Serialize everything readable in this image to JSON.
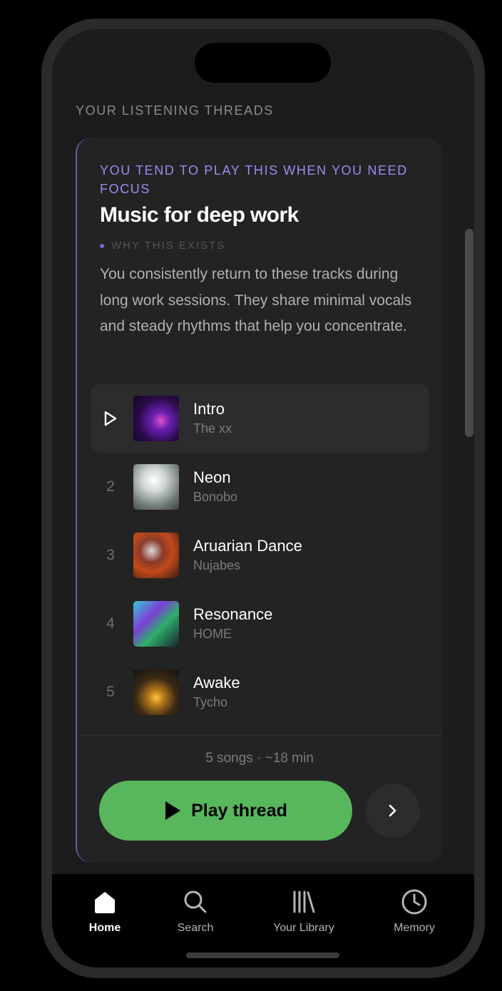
{
  "page": {
    "section_heading": "YOUR LISTENING THREADS"
  },
  "thread": {
    "context_label": "YOU TEND TO PLAY THIS WHEN YOU NEED FOCUS",
    "title": "Music for deep work",
    "why_label": "WHY THIS EXISTS",
    "description": "You consistently return to these tracks during long work sessions. They share minimal vocals and steady rhythms that help you concentrate.",
    "tracks": [
      {
        "number": "1",
        "title": "Intro",
        "artist": "The xx",
        "playing": true
      },
      {
        "number": "2",
        "title": "Neon",
        "artist": "Bonobo"
      },
      {
        "number": "3",
        "title": "Aruarian Dance",
        "artist": "Nujabes"
      },
      {
        "number": "4",
        "title": "Resonance",
        "artist": "HOME"
      },
      {
        "number": "5",
        "title": "Awake",
        "artist": "Tycho"
      }
    ],
    "summary": "5 songs · ~18 min",
    "play_label": "Play thread"
  },
  "tabbar": {
    "tabs": [
      {
        "label": "Home",
        "icon": "home-icon",
        "active": true
      },
      {
        "label": "Search",
        "icon": "search-icon"
      },
      {
        "label": "Your Library",
        "icon": "library-icon"
      },
      {
        "label": "Memory",
        "icon": "clock-icon"
      }
    ]
  },
  "colors": {
    "accent_purple": "#9f8af0",
    "play_green": "#58b65c",
    "background": "#1c1c1c",
    "card": "#232323"
  }
}
